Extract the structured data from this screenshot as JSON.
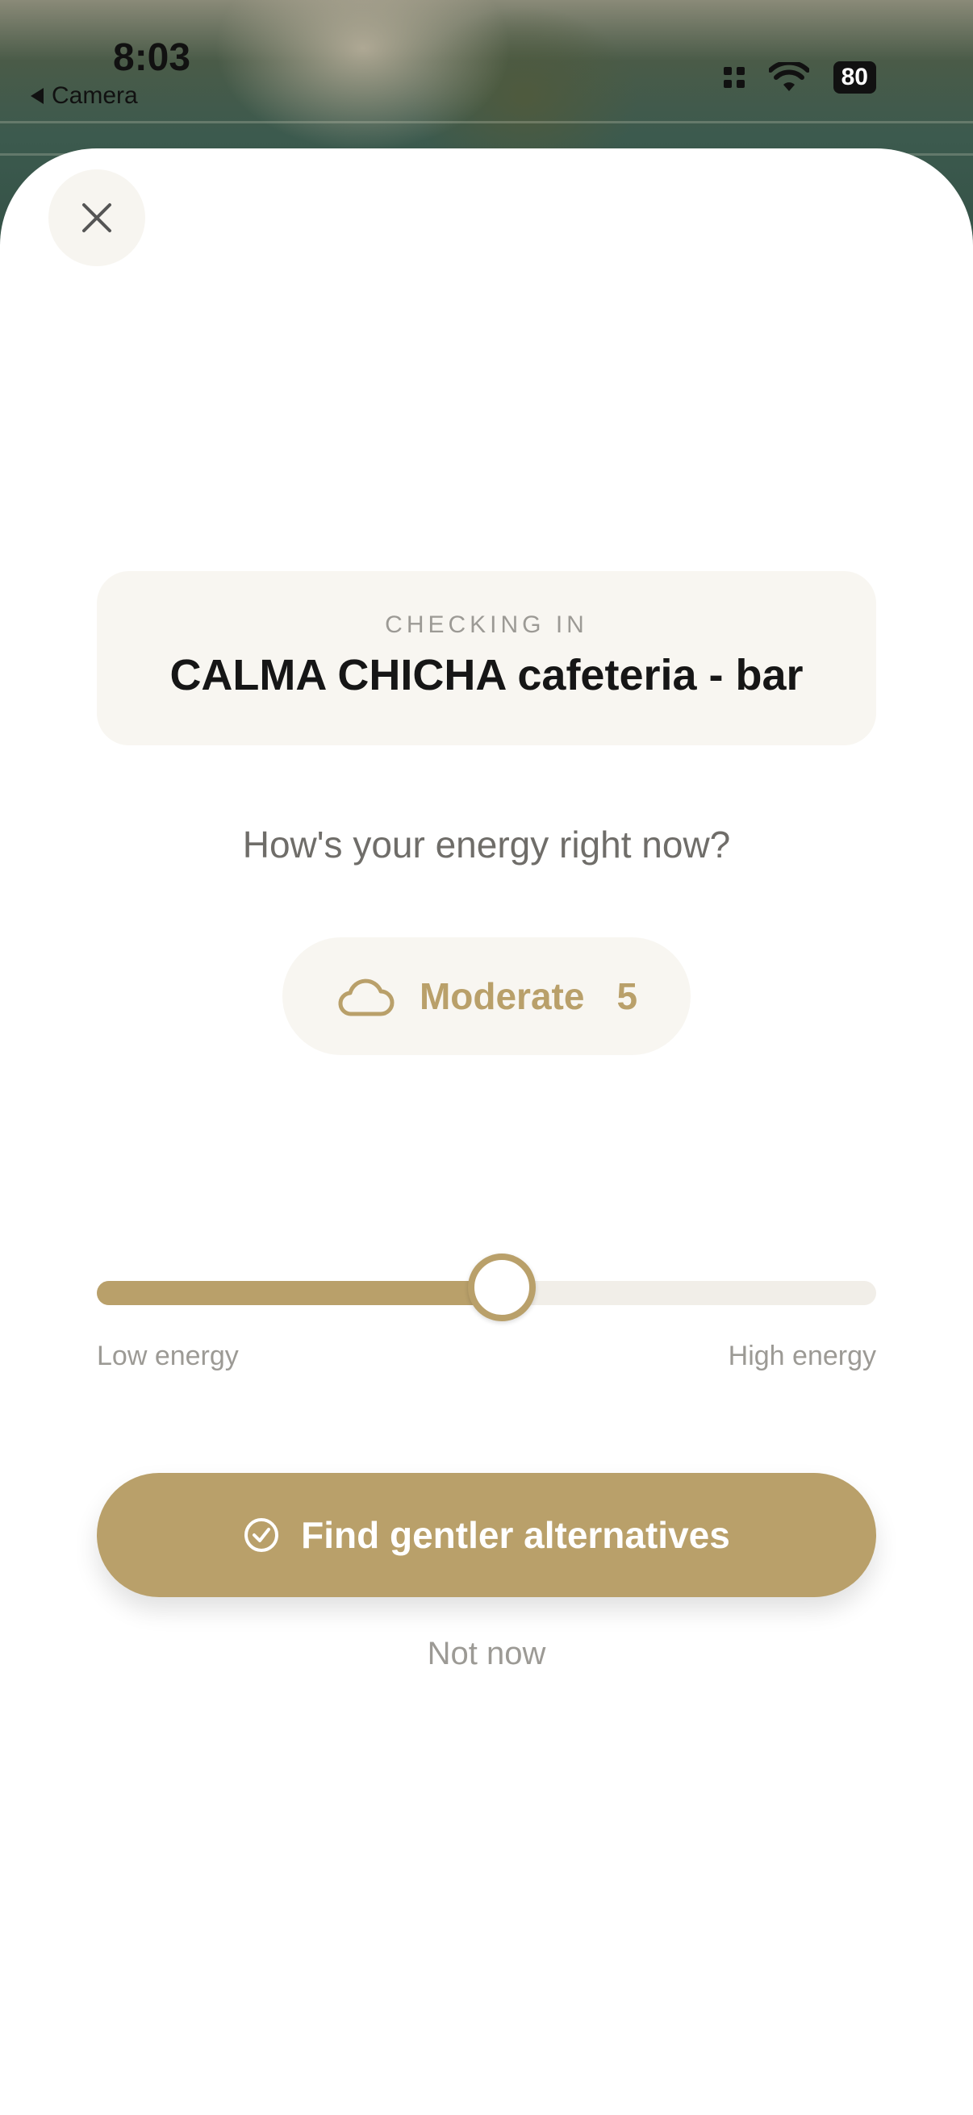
{
  "status_bar": {
    "time": "8:03",
    "back_app": "Camera",
    "battery": "80"
  },
  "sheet": {
    "close_icon": "close-icon",
    "venue": {
      "label": "CHECKING IN",
      "name": "CALMA CHICHA cafeteria - bar"
    },
    "question": "How's your energy right now?",
    "energy": {
      "icon": "cloud-icon",
      "level_label": "Moderate",
      "value": "5",
      "slider_fraction": 0.52
    },
    "slider_labels": {
      "low": "Low energy",
      "high": "High energy"
    },
    "primary_button": {
      "icon": "check-circle-icon",
      "label": "Find gentler alternatives"
    },
    "secondary_button": "Not now"
  },
  "colors": {
    "accent": "#b9a06a",
    "card_bg": "#f8f6f1",
    "muted_text": "#9c9a95"
  }
}
